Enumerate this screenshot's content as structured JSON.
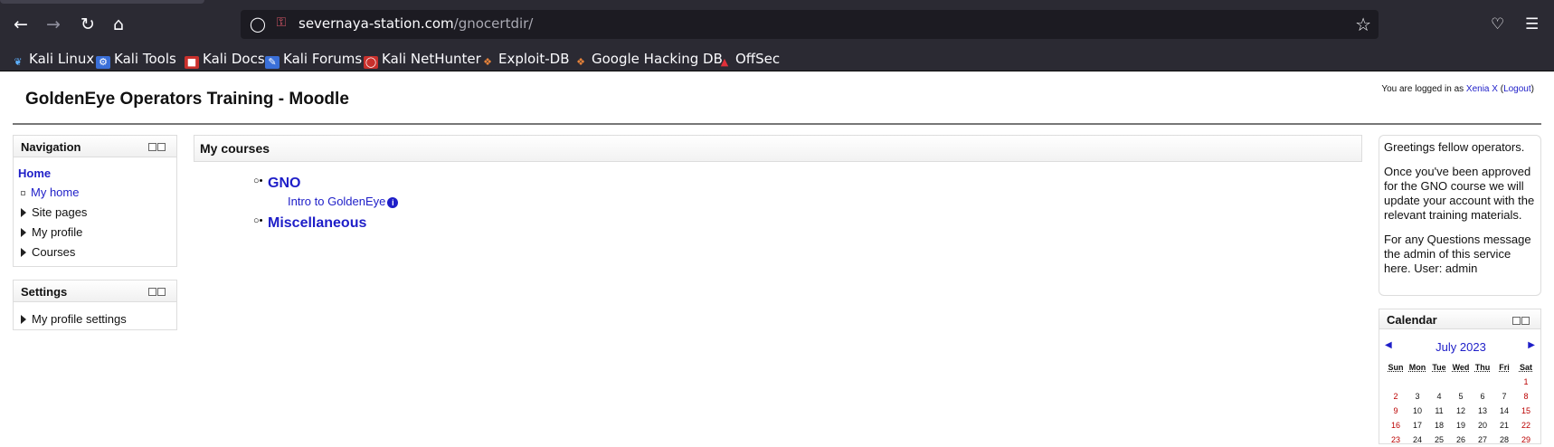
{
  "browser": {
    "url_host": "severnaya-station.com",
    "url_path": "/gnocertdir/",
    "bookmarks": [
      "Kali Linux",
      "Kali Tools",
      "Kali Docs",
      "Kali Forums",
      "Kali NetHunter",
      "Exploit-DB",
      "Google Hacking DB",
      "OffSec"
    ]
  },
  "site": {
    "title": "GoldenEye Operators Training - Moodle",
    "login_prefix": "You are logged in as ",
    "user": "Xenia X",
    "logout": "Logout"
  },
  "navigation": {
    "title": "Navigation",
    "home": "Home",
    "items": [
      "My home",
      "Site pages",
      "My profile",
      "Courses"
    ]
  },
  "settings": {
    "title": "Settings",
    "items": [
      "My profile settings"
    ]
  },
  "main": {
    "header": "My courses",
    "categories": [
      {
        "name": "GNO",
        "courses": [
          "Intro to GoldenEye"
        ]
      },
      {
        "name": "Miscellaneous",
        "courses": []
      }
    ]
  },
  "greeting": {
    "paragraphs": [
      "Greetings fellow operators.",
      "Once you've been approved for the GNO course we will update your account with the relevant training materials.",
      "For any Questions message the admin of this service here. User: admin"
    ]
  },
  "calendar": {
    "title": "Calendar",
    "month": "July 2023",
    "days": [
      "Sun",
      "Mon",
      "Tue",
      "Wed",
      "Thu",
      "Fri",
      "Sat"
    ],
    "weeks": [
      [
        "",
        "",
        "",
        "",
        "",
        "",
        "1"
      ],
      [
        "2",
        "3",
        "4",
        "5",
        "6",
        "7",
        "8"
      ],
      [
        "9",
        "10",
        "11",
        "12",
        "13",
        "14",
        "15"
      ],
      [
        "16",
        "17",
        "18",
        "19",
        "20",
        "21",
        "22"
      ],
      [
        "23",
        "24",
        "25",
        "26",
        "27",
        "28",
        "29"
      ]
    ]
  }
}
